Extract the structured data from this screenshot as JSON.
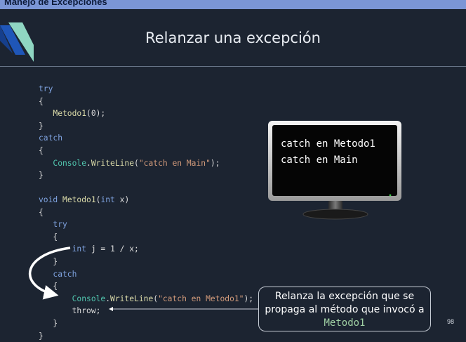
{
  "header": {
    "section_title": "Manejo de Excepciones"
  },
  "slide": {
    "title": "Relanzar una excepción",
    "page_number": "98"
  },
  "code": {
    "l1": "try",
    "l2": "{",
    "l3_fn": "Metodo1",
    "l3_rest": "(0);",
    "l4": "}",
    "l5": "catch",
    "l6": "{",
    "l7_cls": "Console",
    "l7_dot": ".",
    "l7_fn": "WriteLine",
    "l7_open": "(",
    "l7_str": "\"catch en Main\"",
    "l7_close": ");",
    "l8": "}",
    "l10_kw1": "void",
    "l10_fn": "Metodo1",
    "l10_open": "(",
    "l10_kw2": "int",
    "l10_rest": " x)",
    "l11": "{",
    "l12": "try",
    "l13": "{",
    "l14_kw": "int",
    "l14_rest": " j = 1 / x;",
    "l15": "}",
    "l16": "catch",
    "l17": "{",
    "l18_cls": "Console",
    "l18_dot": ".",
    "l18_fn": "WriteLine",
    "l18_open": "(",
    "l18_str": "\"catch en Metodo1\"",
    "l18_close": ");",
    "l19": "throw;",
    "l20": "}",
    "l21": "}"
  },
  "console_output": {
    "line1": "catch en Metodo1",
    "line2": "catch en Main"
  },
  "callout": {
    "text": "Relanza la excepción que se propaga al método que invocó a",
    "code": "Metodo1"
  },
  "colors": {
    "background": "#1c2431",
    "header_bar": "#7b96d6",
    "keyword": "#7fa3e0",
    "class_name": "#52c8b0",
    "string": "#d19a7a"
  }
}
